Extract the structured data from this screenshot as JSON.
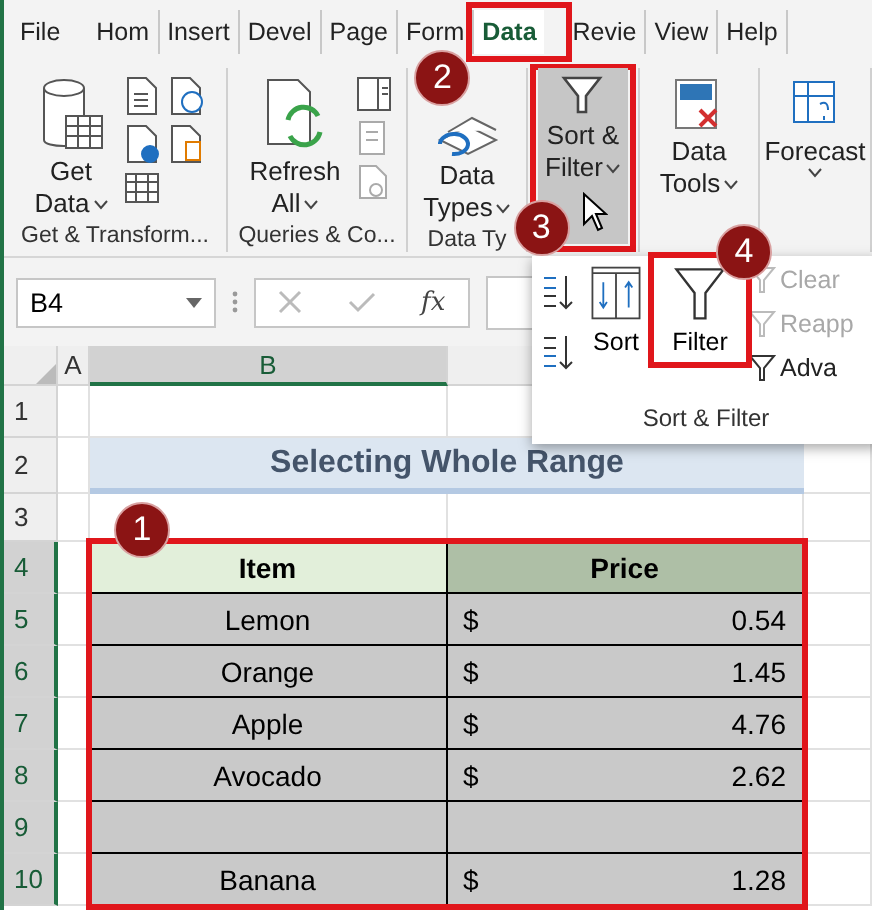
{
  "tabs": [
    {
      "label": "File",
      "selected": false
    },
    {
      "label": "Hom",
      "selected": false
    },
    {
      "label": "Insert",
      "selected": false
    },
    {
      "label": "Devel",
      "selected": false
    },
    {
      "label": "Page",
      "selected": false
    },
    {
      "label": "Form",
      "selected": false
    },
    {
      "label": "Data",
      "selected": true,
      "callout": "2"
    },
    {
      "label": "Revie",
      "selected": false
    },
    {
      "label": "View",
      "selected": false
    },
    {
      "label": "Help",
      "selected": false
    }
  ],
  "ribbon_groups": [
    {
      "kind": "get",
      "label": "Get & Transform...",
      "lines": [
        "Get",
        "Data"
      ],
      "dropdown": true,
      "pressed": false
    },
    {
      "kind": "queries",
      "label": "Queries & Co...",
      "lines": [
        "Refresh",
        "All"
      ],
      "dropdown": true,
      "pressed": false
    },
    {
      "kind": "types",
      "label": "Data Ty",
      "lines": [
        "Data",
        "Types"
      ],
      "dropdown": true,
      "pressed": false
    },
    {
      "kind": "sort",
      "lines": [
        "Sort &",
        "Filter"
      ],
      "dropdown": true,
      "pressed": true,
      "callout": "3"
    },
    {
      "kind": "tools",
      "lines": [
        "Data",
        "Tools"
      ],
      "dropdown": true,
      "pressed": false
    },
    {
      "kind": "forecast",
      "lines": [
        "Forecast"
      ],
      "dropdown": true,
      "pressed": false
    }
  ],
  "formula_bar": {
    "name_box": "B4",
    "function_label": "fx"
  },
  "columns": [
    {
      "label": "A",
      "selected": false
    },
    {
      "label": "B",
      "selected": true
    }
  ],
  "row_headers": [
    {
      "label": "1",
      "selected": false
    },
    {
      "label": "2",
      "selected": false
    },
    {
      "label": "3",
      "selected": false
    },
    {
      "label": "4",
      "selected": true
    },
    {
      "label": "5",
      "selected": true
    },
    {
      "label": "6",
      "selected": true
    },
    {
      "label": "7",
      "selected": true
    },
    {
      "label": "8",
      "selected": true
    },
    {
      "label": "9",
      "selected": true
    },
    {
      "label": "10",
      "selected": true
    }
  ],
  "sheet": {
    "title": "Selecting Whole Range",
    "table": {
      "callout": "1",
      "columns": [
        "Item",
        "Price"
      ],
      "rows": [
        {
          "item": "Lemon",
          "currency": "$",
          "price": "0.54"
        },
        {
          "item": "Orange",
          "currency": "$",
          "price": "1.45"
        },
        {
          "item": "Apple",
          "currency": "$",
          "price": "4.76"
        },
        {
          "item": "Avocado",
          "currency": "$",
          "price": "2.62"
        },
        {},
        {
          "item": "Banana",
          "currency": "$",
          "price": "1.28"
        }
      ]
    }
  },
  "menu": {
    "label": "Sort & Filter",
    "items": [
      {
        "kind": "sort_az"
      },
      {
        "kind": "sort_za"
      },
      {
        "kind": "sort_dialog",
        "label": "Sort"
      },
      {
        "kind": "filter",
        "label": "Filter",
        "callout": "4"
      },
      {
        "kind": "clear",
        "label": "Clear",
        "disabled": true
      },
      {
        "kind": "reapply",
        "label": "Reapp",
        "disabled": true
      },
      {
        "kind": "advanced",
        "label": "Adva",
        "disabled": false
      }
    ]
  }
}
